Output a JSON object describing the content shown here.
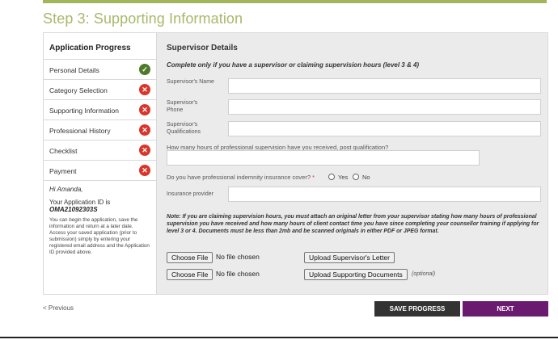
{
  "step_title": "Step 3: Supporting Information",
  "sidebar": {
    "title": "Application Progress",
    "items": [
      {
        "label": "Personal Details",
        "status": "done"
      },
      {
        "label": "Category Selection",
        "status": "incomplete"
      },
      {
        "label": "Supporting Information",
        "status": "incomplete"
      },
      {
        "label": "Professional History",
        "status": "incomplete"
      },
      {
        "label": "Checklist",
        "status": "incomplete"
      },
      {
        "label": "Payment",
        "status": "incomplete"
      }
    ],
    "greeting": "Hi Amanda,",
    "app_id_label": "Your Application ID is",
    "app_id": "OMA21092303S",
    "info_text": "You can begin the application, save the information and return at a later date. Access your saved application (prior to submission) simply by entering your registered email address and the Application ID provided above."
  },
  "form": {
    "section_title": "Supervisor Details",
    "subtitle": "Complete only if you have a supervisor or claiming supervision hours (level 3 & 4)",
    "supervisor_name_label": "Supervisor's Name",
    "supervisor_phone_label": "Supervisor's Phone",
    "supervisor_quals_label": "Supervisor's Qualifications",
    "hours_question": "How many hours of professional supervision have you received, post qualification?",
    "insurance_question": "Do you have professional indemnity insurance cover?",
    "required_mark": "*",
    "yes_label": "Yes",
    "no_label": "No",
    "insurance_provider_label": "Insurance provider",
    "note": "Note: If you are claiming supervision hours, you must attach an original letter from your supervisor stating how many hours of professional supervision you have received and how many hours of client contact time you have since completing your counsellor training if applying for level 3 or 4. Documents must be less than 2mb and be scanned originals in either PDF or JPEG format.",
    "choose_file_label": "Choose File",
    "no_file_text": "No file chosen",
    "upload_letter_label": "Upload Supervisor's Letter",
    "upload_docs_label": "Upload Supporting Documents",
    "optional_text": "(optional)"
  },
  "nav": {
    "previous": "< Previous",
    "save": "SAVE PROGRESS",
    "next": "NEXT"
  },
  "colors": {
    "accent_green": "#a8b86b",
    "done": "#4d7a2a",
    "incomplete": "#d9352b",
    "next_button": "#6a1b6f",
    "save_button": "#333333"
  }
}
